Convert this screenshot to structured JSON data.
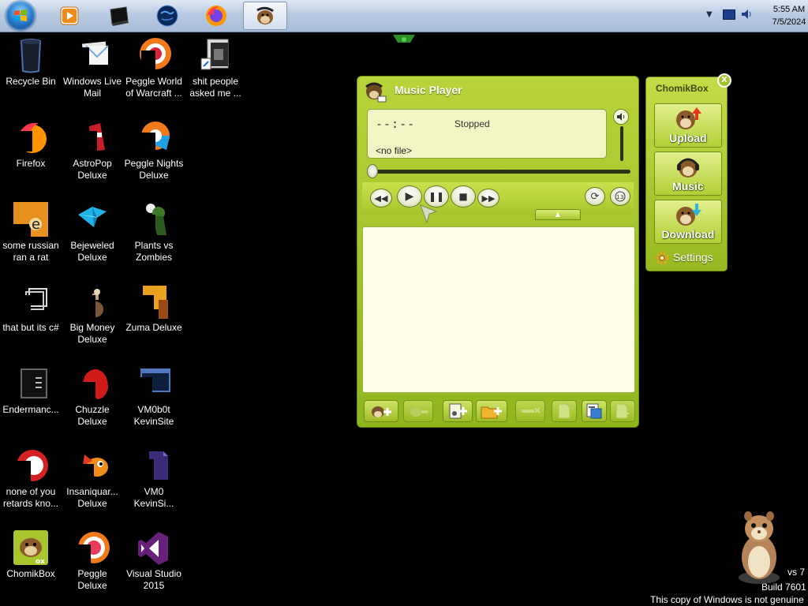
{
  "taskbar": {
    "apps": [
      {
        "name": "media-player-icon"
      },
      {
        "name": "terminal-icon"
      },
      {
        "name": "globe-icon"
      },
      {
        "name": "firefox-icon"
      },
      {
        "name": "chomikbox-icon",
        "active": true
      }
    ],
    "clock": {
      "time": "5:55 AM",
      "date": "7/5/2024"
    }
  },
  "desktop": {
    "icons": [
      {
        "label": "Recycle Bin",
        "icon": "recycle-bin-icon"
      },
      {
        "label": "Windows Live Mail",
        "icon": "windows-live-mail-icon"
      },
      {
        "label": "Peggle World of Warcraft ...",
        "icon": "peggle-wow-icon"
      },
      {
        "label": "shit people asked me ...",
        "icon": "shortcut-file-icon"
      },
      {
        "label": "Firefox",
        "icon": "firefox-icon"
      },
      {
        "label": "AstroPop Deluxe",
        "icon": "astropop-icon"
      },
      {
        "label": "Peggle Nights Deluxe",
        "icon": "peggle-nights-icon"
      },
      {
        "label": "some russian ran a rat",
        "icon": "orange-app-icon"
      },
      {
        "label": "Bejeweled Deluxe",
        "icon": "bejeweled-icon"
      },
      {
        "label": "Plants vs Zombies",
        "icon": "plants-vs-zombies-icon"
      },
      {
        "label": "that but its c#",
        "icon": "shortcut-folder-icon"
      },
      {
        "label": "Big Money Deluxe",
        "icon": "big-money-icon"
      },
      {
        "label": "Zuma Deluxe",
        "icon": "zuma-icon"
      },
      {
        "label": "Endermanc...",
        "icon": "terminal-window-icon"
      },
      {
        "label": "Chuzzle Deluxe",
        "icon": "chuzzle-icon"
      },
      {
        "label": "VM0b0t KevinSite",
        "icon": "vm-window-icon"
      },
      {
        "label": "none of you retards kno...",
        "icon": "red-circle-icon"
      },
      {
        "label": "Insaniquar... Deluxe",
        "icon": "insaniquarium-icon"
      },
      {
        "label": "VM0 KevinSi...",
        "icon": "vm-file-icon"
      },
      {
        "label": "ChomikBox",
        "icon": "chomikbox-icon"
      },
      {
        "label": "Peggle Deluxe",
        "icon": "peggle-icon"
      },
      {
        "label": "Visual Studio 2015",
        "icon": "visual-studio-icon"
      }
    ]
  },
  "player": {
    "title": "Music Player",
    "time": "--:--",
    "status": "Stopped",
    "file": "<no file>",
    "progress": 0
  },
  "chomikbox": {
    "title": "ChomikBox",
    "close": "X",
    "buttons": [
      {
        "label": "Upload"
      },
      {
        "label": "Music"
      },
      {
        "label": "Download"
      }
    ],
    "settings": "Settings"
  },
  "watermark": {
    "line1": "vs 7",
    "line2": "Build 7601",
    "line3": "This copy of Windows is not genuine"
  },
  "colors": {
    "accent": "#a6c52a",
    "accent_dark": "#6a8c12",
    "display": "#f1f5c3"
  }
}
